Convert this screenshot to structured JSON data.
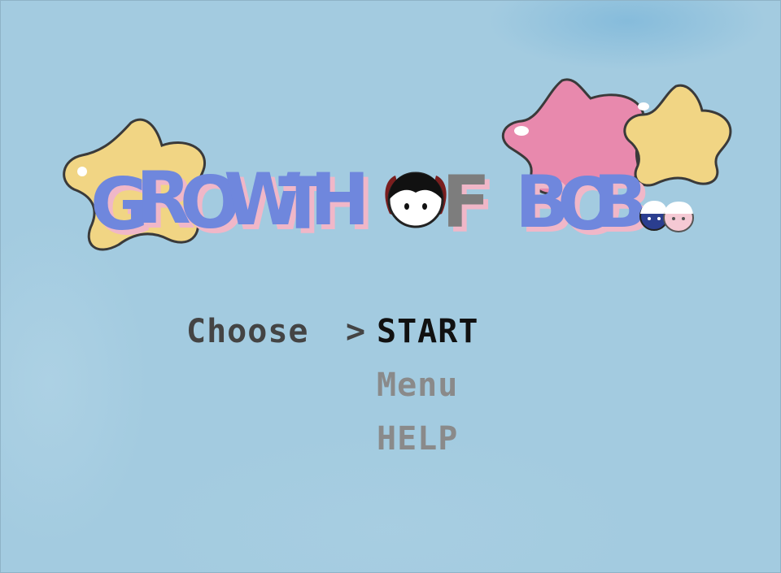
{
  "title": {
    "word1": [
      "G",
      "R",
      "O",
      "W",
      "T",
      "H"
    ],
    "word2_letter": "F",
    "word3": [
      "B",
      "O",
      "B"
    ]
  },
  "menu": {
    "choose_label": "Choose",
    "cursor": ">",
    "options": [
      {
        "label": "START",
        "selected": true
      },
      {
        "label": "Menu",
        "selected": false
      },
      {
        "label": "HELP",
        "selected": false
      }
    ]
  },
  "colors": {
    "background": "#a3cbe0",
    "star_yellow": "#f1d584",
    "star_pink": "#e889ad",
    "letter_blue": "#6f87dd",
    "letter_shadow": "#f0b7c8",
    "selected_text": "#111111",
    "unselected_text": "#8a8a8a"
  }
}
